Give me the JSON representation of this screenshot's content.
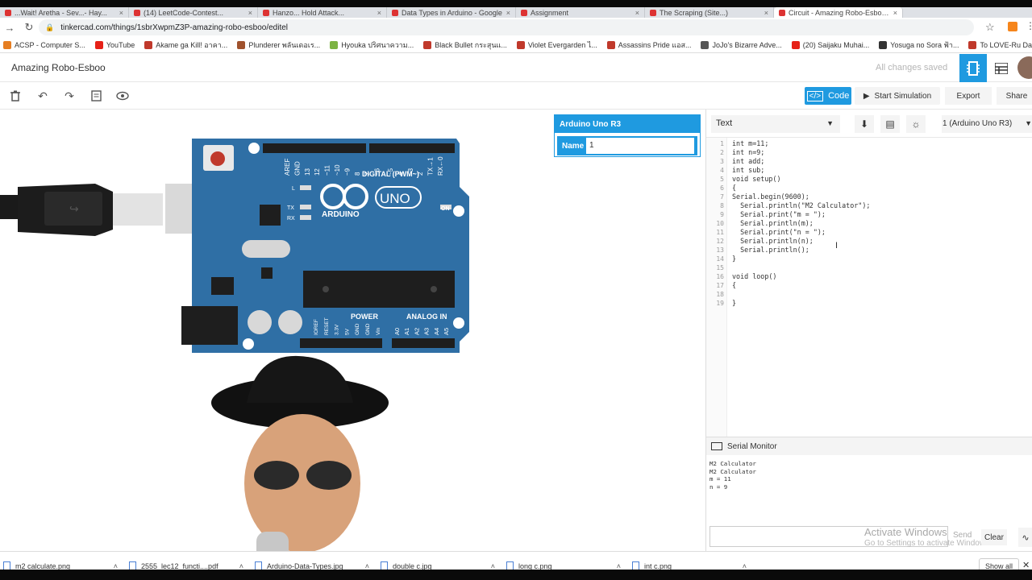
{
  "browser": {
    "tabs": [
      {
        "label": "...Wait! Aretha - Sev...- Hay..."
      },
      {
        "label": "(14) LeetCode-Contest..."
      },
      {
        "label": "Hanzo... Hold Attack..."
      },
      {
        "label": "Data Types in Arduino - Google"
      },
      {
        "label": "Assignment"
      },
      {
        "label": "The Scraping (Site...)"
      },
      {
        "label": "Circuit - Amazing Robo-Esboo | T..."
      }
    ],
    "url": "tinkercad.com/things/1sbrXwpmZ3P-amazing-robo-esboo/editel",
    "bookmarks": [
      {
        "label": "ACSP - Computer S...",
        "color": "#e67e22"
      },
      {
        "label": "YouTube",
        "color": "#e62117"
      },
      {
        "label": "Akame ga Kill! อาคา...",
        "color": "#c0392b"
      },
      {
        "label": "Plunderer พลันเดอเร...",
        "color": "#a0522d"
      },
      {
        "label": "Hyouka ปริศนาความ...",
        "color": "#7cb342"
      },
      {
        "label": "Black Bullet กระสุนแ...",
        "color": "#c0392b"
      },
      {
        "label": "Violet Evergarden ไ...",
        "color": "#c0392b"
      },
      {
        "label": "Assassins Pride แอส...",
        "color": "#c0392b"
      },
      {
        "label": "JoJo's Bizarre Adve...",
        "color": "#555555"
      },
      {
        "label": "(20) Saijaku Muhai...",
        "color": "#e62117"
      },
      {
        "label": "Yosuga no Sora ฟ้า...",
        "color": "#333333"
      },
      {
        "label": "To LOVE-Ru Darkne...",
        "color": "#c0392b"
      }
    ]
  },
  "app": {
    "title": "Amazing Robo-Esboo",
    "saved_status": "All changes saved",
    "accent": "#1f9ae0"
  },
  "toolbar": {
    "code_label": "Code",
    "simulate_label": "Start Simulation",
    "export_label": "Export",
    "share_label": "Share"
  },
  "inspector": {
    "title": "Arduino Uno R3",
    "name_label": "Name",
    "name_value": "1"
  },
  "board": {
    "digital_label": "DIGITAL (PWM~)",
    "brand": "ARDUINO",
    "model": "UNO",
    "on_label": "ON",
    "power_label": "POWER",
    "analog_label": "ANALOG IN",
    "tx_label": "TX",
    "rx_label": "RX",
    "l_label": "L",
    "digital_pins": [
      "AREF",
      "GND",
      "13",
      "12",
      "~11",
      "~10",
      "~9",
      "8",
      "7",
      "~6",
      "~5",
      "4",
      "~3",
      "2",
      "TX→1",
      "RX←0"
    ],
    "power_pins": [
      "IOREF",
      "RESET",
      "3.3V",
      "5V",
      "GND",
      "GND",
      "Vin"
    ],
    "analog_pins": [
      "A0",
      "A1",
      "A2",
      "A3",
      "A4",
      "A5"
    ]
  },
  "code_panel": {
    "mode": "Text",
    "device": "1 (Arduino Uno R3)",
    "lines": [
      "int m=11;",
      "int n=9;",
      "int add;",
      "int sub;",
      "void setup()",
      "{",
      "Serial.begin(9600);",
      "  Serial.println(\"M2 Calculator\");",
      "  Serial.print(\"m = \");",
      "  Serial.println(m);",
      "  Serial.print(\"n = \");",
      "  Serial.println(n);",
      "  Serial.println();",
      "}",
      "",
      "void loop()",
      "{",
      "",
      "}"
    ]
  },
  "serial_monitor": {
    "title": "Serial Monitor",
    "output": [
      "M2 Calculator",
      "M2 Calculator",
      "m = 11",
      "n = 9"
    ],
    "send_label": "Send",
    "clear_label": "Clear",
    "watermark_line1": "Activate Windows",
    "watermark_line2": "Go to Settings to activate Windows."
  },
  "downloads": {
    "items": [
      {
        "label": "m2 calculate.png"
      },
      {
        "label": "2555_lec12_functi....pdf"
      },
      {
        "label": "Arduino-Data-Types.jpg"
      },
      {
        "label": "double c.jpg"
      },
      {
        "label": "long c.png"
      },
      {
        "label": "int c.png"
      }
    ],
    "show_all_label": "Show all"
  }
}
